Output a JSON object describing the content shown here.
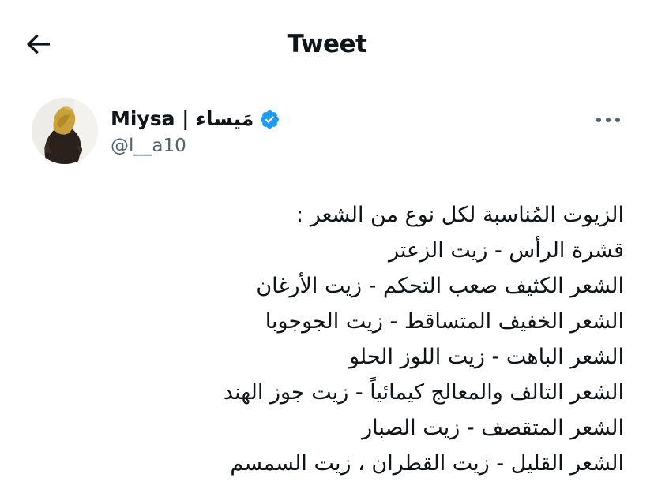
{
  "header": {
    "title": "Tweet",
    "back_icon": "arrow-left-icon"
  },
  "author": {
    "display_name": "Miysa | مَيساء",
    "handle": "@l__a10",
    "verified": true,
    "verified_color": "#1d9bf0",
    "avatar_icon": "profile-photo"
  },
  "more_icon": "ellipsis-icon",
  "tweet": {
    "lines": [
      "الزيوت المُناسبة لكل نوع من الشعر :",
      "قشرة الرأس - زيت الزعتر",
      "الشعر الكثيف صعب التحكم - زيت الأرغان",
      "الشعر الخفيف المتساقط - زيت الجوجوبا",
      "الشعر الباهت - زيت اللوز الحلو",
      "الشعر التالف والمعالج كيمائياً - زيت جوز الهند",
      "الشعر المتقصف - زيت الصبار",
      "الشعر القليل - زيت القطران ، زيت السمسم"
    ]
  },
  "colors": {
    "text": "#0f1419",
    "secondary_text": "#536471",
    "background": "#ffffff",
    "accent": "#1d9bf0"
  }
}
